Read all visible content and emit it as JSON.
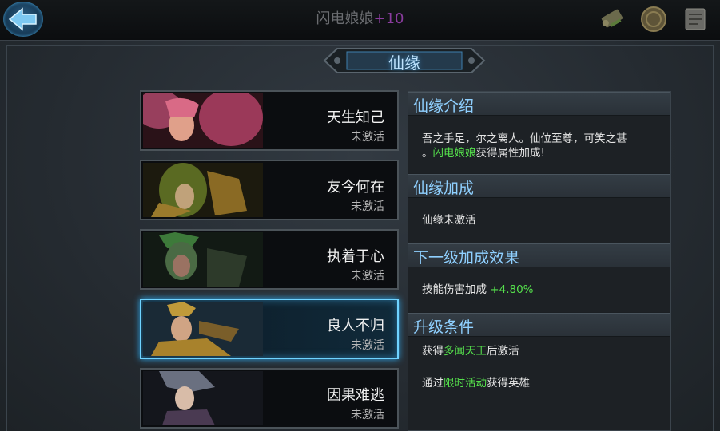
{
  "header": {
    "hero_name": "闪电娘娘",
    "hero_level": "+10",
    "icons": [
      "back-arrow-icon",
      "scroll-icon",
      "coin-icon",
      "document-icon"
    ]
  },
  "panel": {
    "title": "仙缘"
  },
  "fates": [
    {
      "name": "天生知己",
      "status": "未激活",
      "selected": false
    },
    {
      "name": "友今何在",
      "status": "未激活",
      "selected": false
    },
    {
      "name": "执着于心",
      "status": "未激活",
      "selected": false
    },
    {
      "name": "良人不归",
      "status": "未激活",
      "selected": true
    },
    {
      "name": "因果难逃",
      "status": "未激活",
      "selected": false
    }
  ],
  "info": {
    "intro": {
      "title": "仙缘介绍",
      "line1": "吾之手足，尔之离人。仙位至尊，可笑之甚",
      "line2_prefix": "。",
      "line2_hero": "闪电娘娘",
      "line2_suffix": "获得属性加成!"
    },
    "bonus": {
      "title": "仙缘加成",
      "text": "仙缘未激活"
    },
    "next": {
      "title": "下一级加成效果",
      "label": "技能伤害加成",
      "value": "+4.80%"
    },
    "upgrade": {
      "title": "升级条件",
      "cond1_prefix": "获得",
      "cond1_hero": "多闻天王",
      "cond1_suffix": "后激活",
      "cond2_prefix": "通过",
      "cond2_event": "限时活动",
      "cond2_suffix": "获得英雄"
    }
  },
  "colors": {
    "accent_blue": "#8fd0ff",
    "highlight_green": "#55e04c",
    "level_purple": "#8a3c9e",
    "selected_border": "#6fd3ff"
  }
}
